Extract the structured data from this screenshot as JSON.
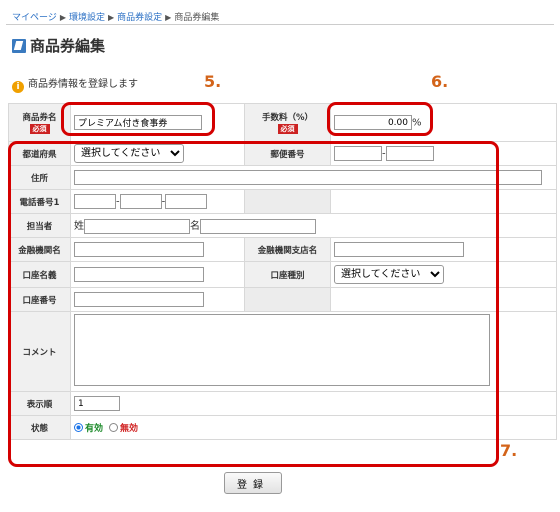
{
  "breadcrumb": {
    "items": [
      "マイページ",
      "環境設定",
      "商品券設定",
      "商品券編集"
    ],
    "separator": "▶"
  },
  "page": {
    "title": "商品券編集",
    "info": "商品券情報を登録します"
  },
  "annotations": {
    "a5": "5.",
    "a6": "6.",
    "a7": "7."
  },
  "form": {
    "name_label": "商品券名",
    "required": "必須",
    "name_value": "プレミアム付き食事券",
    "fee_label": "手数料（%）",
    "fee_value": "0.00",
    "fee_unit": "%",
    "pref_label": "都道府県",
    "select_placeholder": "選択してください",
    "zip_label": "郵便番号",
    "zip_sep": "-",
    "address_label": "住所",
    "phone_label": "電話番号1",
    "phone_sep": "-",
    "person_label": "担当者",
    "last_name": "姓",
    "first_name": "名",
    "bank_label": "金融機関名",
    "branch_label": "金融機関支店名",
    "holder_label": "口座名義",
    "acct_type_label": "口座種別",
    "acct_no_label": "口座番号",
    "comment_label": "コメント",
    "order_label": "表示順",
    "order_value": "1",
    "status_label": "状態",
    "status_on": "有効",
    "status_off": "無効"
  },
  "submit_label": "登録",
  "colors": {
    "highlight": "#d40000",
    "annotation": "#d3641a",
    "link": "#2a6fc4",
    "required_badge": "#cc2222"
  }
}
